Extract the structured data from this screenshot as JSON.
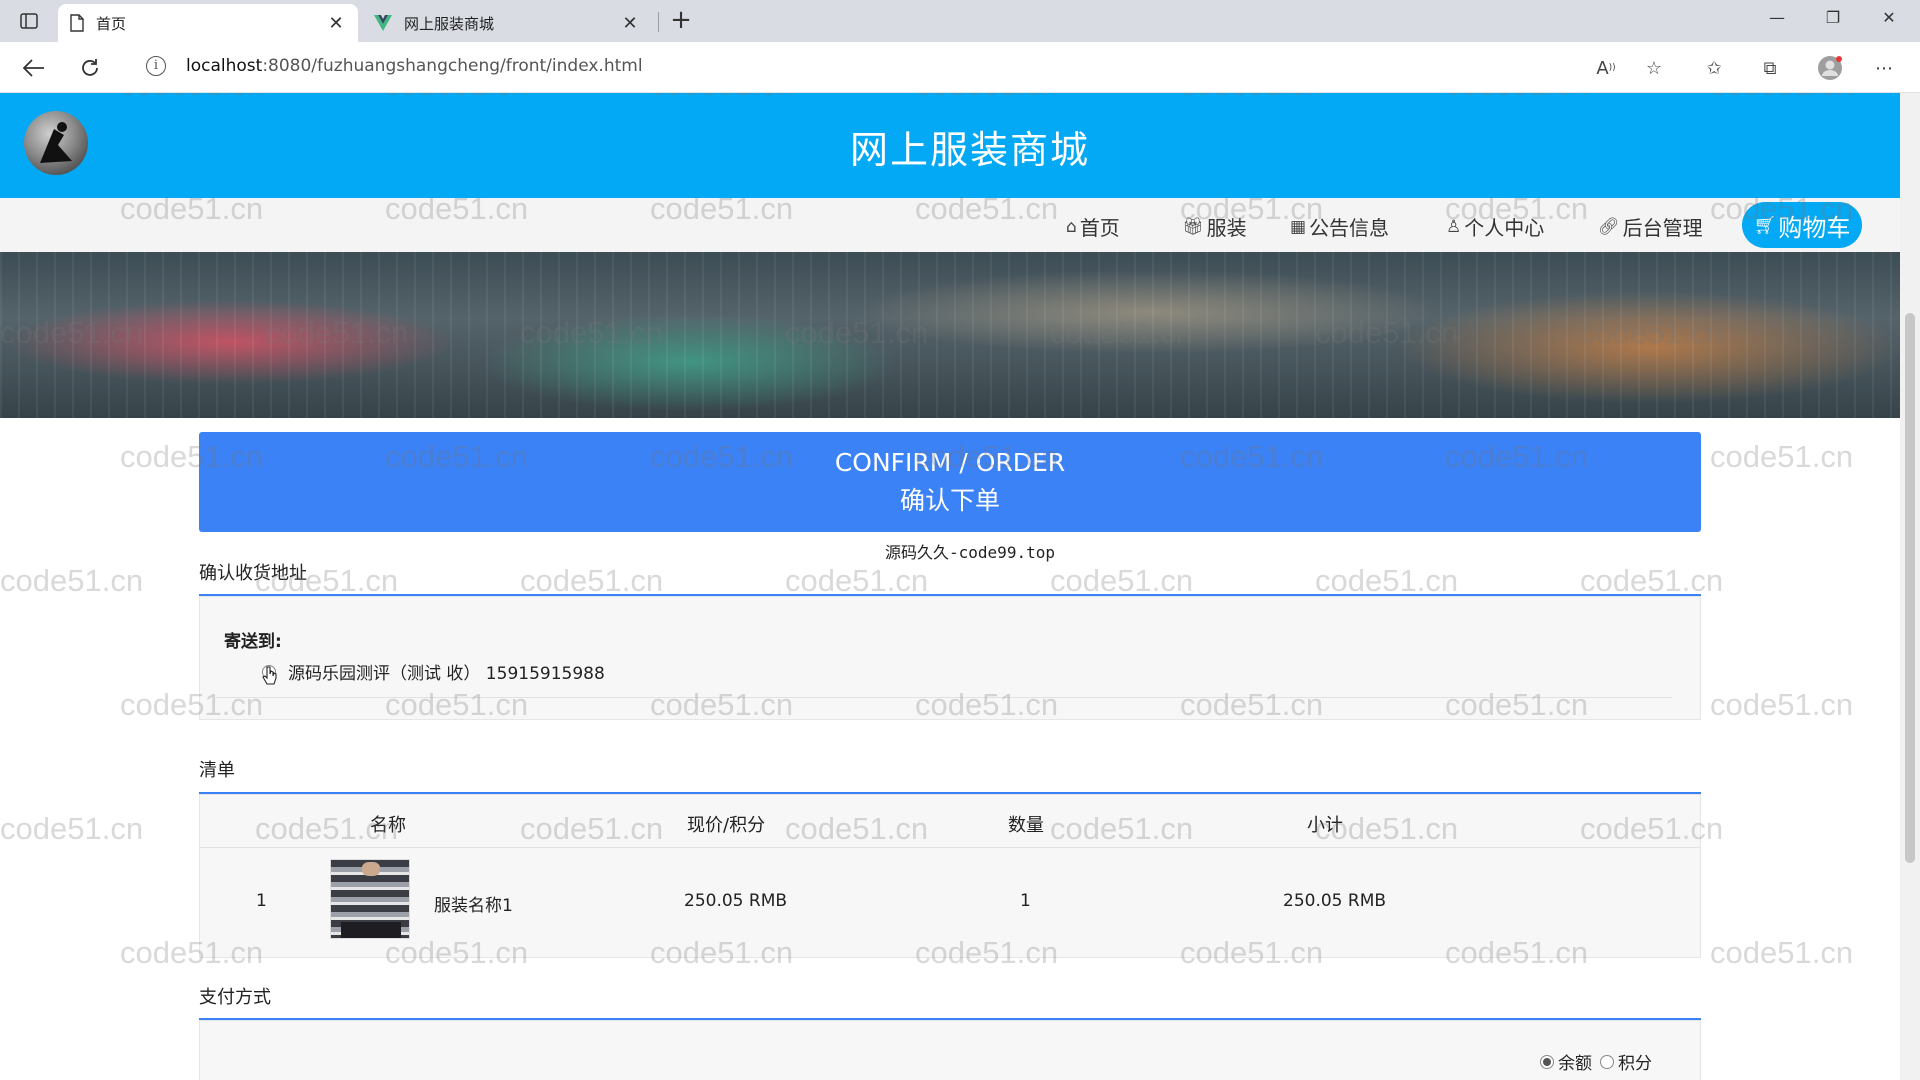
{
  "browser": {
    "tabs": [
      {
        "title": "首页",
        "active": true
      },
      {
        "title": "网上服装商城",
        "active": false
      }
    ],
    "new_tab_glyph": "+",
    "url_host": "localhost",
    "url_rest": ":8080/fuzhuangshangcheng/front/index.html"
  },
  "site": {
    "title": "网上服装商城",
    "nav": [
      "首页",
      "服装",
      "公告信息",
      "个人中心",
      "后台管理"
    ],
    "cart_label": "购物车",
    "accent_color": "#03a9f4"
  },
  "confirm": {
    "title_en": "CONFIRM / ORDER",
    "title_cn": "确认下单",
    "color": "#3b82f6"
  },
  "source_note": "源码久久-code99.top",
  "address": {
    "section_title": "确认收货地址",
    "send_to_label": "寄送到:",
    "entries": [
      {
        "text": "源码乐园测评（测试 收） 15915915988",
        "selected": false
      }
    ]
  },
  "order_list": {
    "section_title": "清单",
    "headers": [
      "名称",
      "现价/积分",
      "数量",
      "小计"
    ],
    "rows": [
      {
        "index": "1",
        "name": "服装名称1",
        "price": "250.05 RMB",
        "quantity": "1",
        "subtotal": "250.05 RMB"
      }
    ]
  },
  "payment": {
    "section_title": "支付方式",
    "options": [
      {
        "label": "余额",
        "selected": true
      },
      {
        "label": "积分",
        "selected": false
      }
    ]
  },
  "watermark": "code51.cn"
}
